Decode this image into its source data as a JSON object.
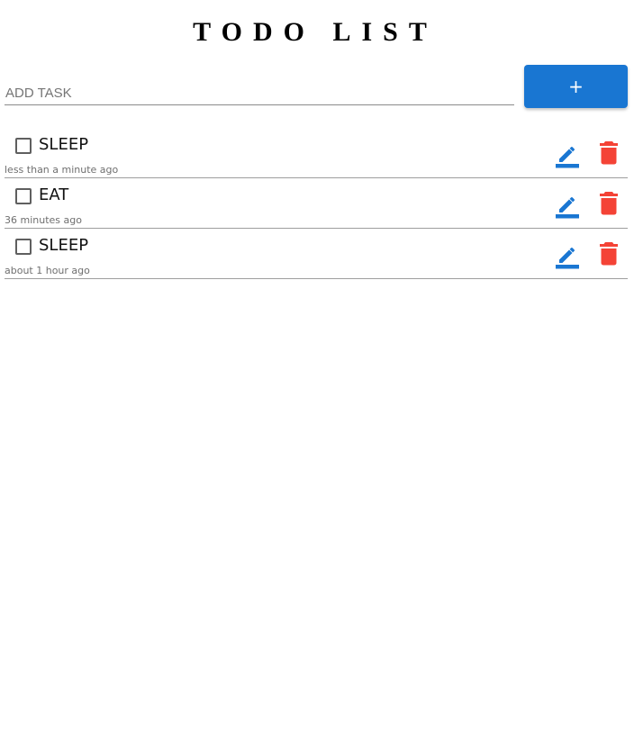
{
  "app": {
    "title": "TODO LIST"
  },
  "add_task": {
    "placeholder": "ADD TASK",
    "value": "",
    "button_label": "+"
  },
  "colors": {
    "primary": "#1976d2",
    "danger": "#f44336",
    "divider": "#9e9e9e"
  },
  "tasks": [
    {
      "text": "SLEEP",
      "time": "less than a minute ago",
      "checked": false
    },
    {
      "text": "EAT",
      "time": "36 minutes ago",
      "checked": false
    },
    {
      "text": "SLEEP",
      "time": "about 1 hour ago",
      "checked": false
    }
  ],
  "icons": {
    "edit": "pencil-icon",
    "delete": "trash-icon"
  }
}
